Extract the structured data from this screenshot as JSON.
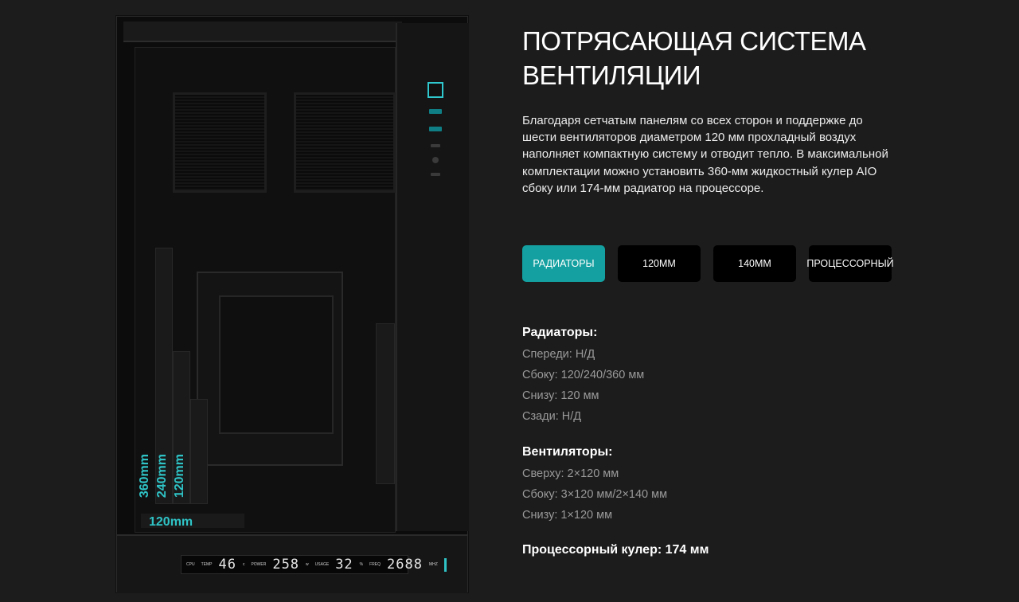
{
  "heading": "ПОТРЯСАЮЩАЯ СИСТЕМА\nВЕНТИЛЯЦИИ",
  "description": "Благодаря сетчатым панелям со всех сторон и поддержке до шести вентиляторов диаметром 120 мм прохладный воздух наполняет компактную систему и отводит тепло. В максимальной комплектации можно установить 360-мм жидкостный кулер AIO сбоку или 174-мм радиатор на процессоре.",
  "tabs": [
    {
      "label": "РАДИАТОРЫ",
      "active": true
    },
    {
      "label": "120ММ",
      "active": false
    },
    {
      "label": "140ММ",
      "active": false
    },
    {
      "label": "ПРОЦЕССОРНЫЙ",
      "active": false
    }
  ],
  "radiators": {
    "title": "Радиаторы:",
    "lines": [
      "Спереди: Н/Д",
      "Сбоку: 120/240/360 мм",
      "Снизу: 120 мм",
      "Сзади: Н/Д"
    ]
  },
  "fans": {
    "title": "Вентиляторы:",
    "lines": [
      "Сверху: 2×120 мм",
      "Сбоку: 3×120 мм/2×140 мм",
      "Снизу: 1×120 мм"
    ]
  },
  "cpu_cooler": "Процессорный кулер: 174 мм",
  "image": {
    "size_labels": [
      "360mm",
      "240mm",
      "120mm"
    ],
    "bottom_label": "120mm",
    "lcd": {
      "cpu": "CPU",
      "temp_label": "TEMP",
      "temp_value": "46",
      "temp_unit": "c",
      "power_label": "POWER",
      "power_value": "258",
      "power_unit": "w",
      "usage_label": "USAGE",
      "usage_value": "32",
      "usage_unit": "%",
      "freq_label": "FREQ",
      "freq_value": "2688",
      "freq_unit": "MHZ"
    },
    "accent_color": "#2fc3c6"
  },
  "colors": {
    "background": "#1c1c1c",
    "active_tab": "#14a0a0",
    "inactive_tab": "#000000"
  }
}
